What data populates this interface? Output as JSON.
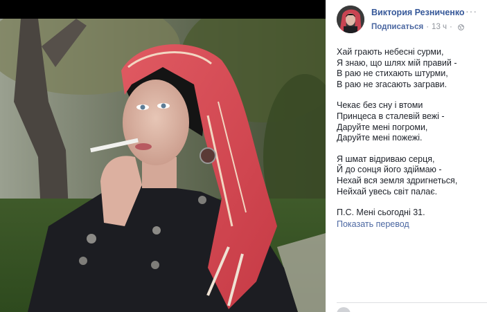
{
  "photo": {
    "subject": "woman-in-red-scarf-smoking"
  },
  "post": {
    "author": "Виктория Резниченко",
    "follow_label": "Подписаться",
    "separator": "·",
    "time": "13 ч",
    "privacy_icon": "globe-icon",
    "more_icon": "more-options-icon",
    "stanzas": [
      [
        "Хай грають небесні сурми,",
        "Я знаю, що шлях мій правий -",
        "В раю не стихають штурми,",
        "В раю не згасають заграви."
      ],
      [
        "Чекає без сну і втоми",
        "Принцеса в сталевій вежі -",
        "Даруйте мені погроми,",
        "Даруйте мені пожежі."
      ],
      [
        "Я шмат відриваю серця,",
        "Й до сонця його здіймаю -",
        "Нехай вся земля здригнеться,",
        "Нейхай увесь світ палає."
      ]
    ],
    "ps": "П.С. Мені сьогодні 31.",
    "translate_label": "Показать перевод"
  },
  "colors": {
    "link": "#365899",
    "meta": "#90949c",
    "text": "#1d2129",
    "scarf": "#d9454f"
  }
}
